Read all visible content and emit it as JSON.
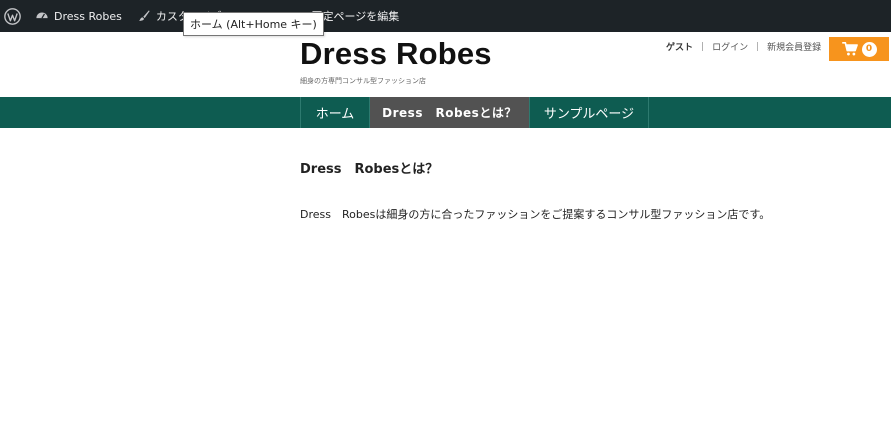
{
  "adminbar": {
    "site_name": "Dress Robes",
    "customize": "カスタマイズ",
    "edit_page": "固定ページを編集",
    "tooltip": "ホーム (Alt+Home キー)"
  },
  "header": {
    "title": "Dress Robes",
    "tagline": "細身の方専門コンサル型ファッション店",
    "guest": "ゲスト",
    "login": "ログイン",
    "register": "新規会員登録",
    "cart_count": "0"
  },
  "nav": {
    "home": "ホーム",
    "about": "Dress　Robesとは？",
    "sample": "サンプルページ"
  },
  "content": {
    "title": "Dress　Robesとは？",
    "body": "Dress　Robesは細身の方に合ったファッションをご提案するコンサル型ファッション店です。"
  },
  "colors": {
    "adminbar_bg": "#1d2327",
    "nav_bg": "#0e5c51",
    "nav_active_bg": "#525252",
    "cart_bg": "#f7941d"
  }
}
